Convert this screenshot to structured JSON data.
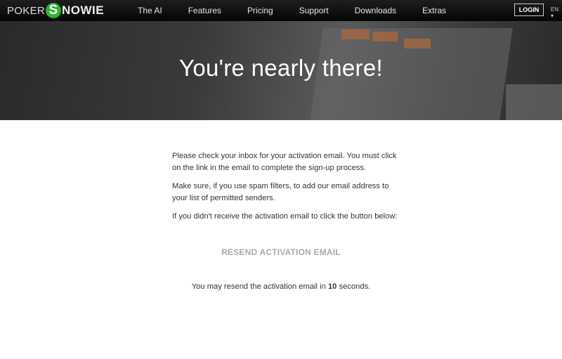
{
  "nav": {
    "logo": {
      "poker": "POKER",
      "s": "S",
      "nowie": "NOWIE"
    },
    "items": [
      "The AI",
      "Features",
      "Pricing",
      "Support",
      "Downloads",
      "Extras"
    ],
    "login": "LOGIN",
    "lang": "EN ▾"
  },
  "hero": {
    "title": "You're nearly there!"
  },
  "main": {
    "paragraphs": [
      "Please check your inbox for your activation email. You must click on the link in the email to complete the sign-up process.",
      "Make sure, if you use spam filters, to add our email address to your list of permitted senders.",
      "If you didn't receive the activation email to click the button below:"
    ],
    "resend_label": "RESEND ACTIVATION EMAIL",
    "timer": {
      "prefix": "You may resend the activation email in ",
      "seconds": "10",
      "suffix": " seconds."
    }
  },
  "colors": {
    "brand_green": "#2db52d",
    "nav_bg": "#111111"
  }
}
